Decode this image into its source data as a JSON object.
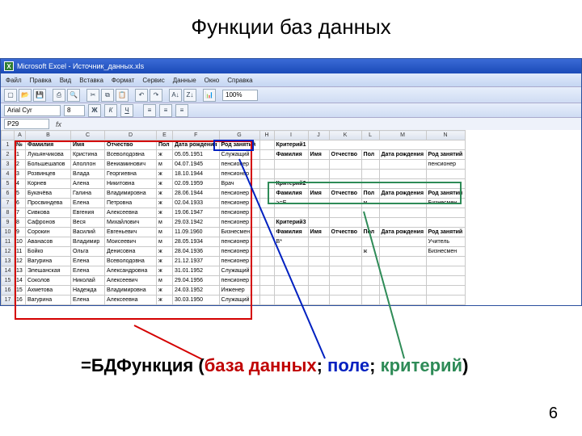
{
  "slide": {
    "title": "Функции баз данных",
    "page_number": "6"
  },
  "window": {
    "app_title": "Microsoft Excel - Источник_данных.xls"
  },
  "menu": {
    "items": [
      "Файл",
      "Правка",
      "Вид",
      "Вставка",
      "Формат",
      "Сервис",
      "Данные",
      "Окно",
      "Справка"
    ]
  },
  "toolbar": {
    "zoom": "100%"
  },
  "format_bar": {
    "font": "Arial Cyr",
    "size": "8"
  },
  "formula_bar": {
    "name_box": "P29",
    "fx": "fx"
  },
  "columns": [
    "",
    "A",
    "B",
    "C",
    "D",
    "E",
    "F",
    "G",
    "H",
    "I",
    "J",
    "K",
    "L",
    "M",
    "N"
  ],
  "db": {
    "headers": {
      "num": "№",
      "fam": "Фамилия",
      "name": "Имя",
      "ot": "Отчество",
      "pol": "Пол",
      "date": "Дата рождения",
      "rod": "Род занятий"
    },
    "rows": [
      {
        "n": "1",
        "fam": "Лукьянчикова",
        "name": "Кристина",
        "ot": "Всеволодовна",
        "pol": "ж",
        "date": "05.05.1951",
        "rod": "Служащий"
      },
      {
        "n": "2",
        "fam": "Большешапов",
        "name": "Аполлон",
        "ot": "Вениаминович",
        "pol": "м",
        "date": "04.07.1945",
        "rod": "пенсионер"
      },
      {
        "n": "3",
        "fam": "Розвинцев",
        "name": "Влада",
        "ot": "Георгиевна",
        "pol": "ж",
        "date": "18.10.1944",
        "rod": "пенсионер"
      },
      {
        "n": "4",
        "fam": "Корнев",
        "name": "Алена",
        "ot": "Никитовна",
        "pol": "ж",
        "date": "02.09.1959",
        "rod": "Врач"
      },
      {
        "n": "5",
        "fam": "Букачёва",
        "name": "Галина",
        "ot": "Владимировна",
        "pol": "ж",
        "date": "28.06.1944",
        "rod": "пенсионер"
      },
      {
        "n": "6",
        "fam": "Просвиндева",
        "name": "Елена",
        "ot": "Петровна",
        "pol": "ж",
        "date": "02.04.1933",
        "rod": "пенсионер"
      },
      {
        "n": "7",
        "fam": "Сивкова",
        "name": "Евгения",
        "ot": "Алексеевна",
        "pol": "ж",
        "date": "19.06.1947",
        "rod": "пенсионер"
      },
      {
        "n": "8",
        "fam": "Сафронов",
        "name": "Веся",
        "ot": "Михайлович",
        "pol": "м",
        "date": "29.03.1942",
        "rod": "пенсионер"
      },
      {
        "n": "9",
        "fam": "Сорокин",
        "name": "Василий",
        "ot": "Евгеньевич",
        "pol": "м",
        "date": "11.09.1960",
        "rod": "Бизнесмен"
      },
      {
        "n": "10",
        "fam": "Аванасов",
        "name": "Владимир",
        "ot": "Моисеевич",
        "pol": "м",
        "date": "28.05.1934",
        "rod": "пенсионер"
      },
      {
        "n": "11",
        "fam": "Бойко",
        "name": "Ольга",
        "ot": "Денисовна",
        "pol": "ж",
        "date": "28.04.1936",
        "rod": "пенсионер"
      },
      {
        "n": "12",
        "fam": "Вагурина",
        "name": "Елена",
        "ot": "Всеволодовна",
        "pol": "ж",
        "date": "21.12.1937",
        "rod": "пенсионер"
      },
      {
        "n": "13",
        "fam": "Элешанская",
        "name": "Елена",
        "ot": "Александровна",
        "pol": "ж",
        "date": "31.01.1952",
        "rod": "Служащий"
      },
      {
        "n": "14",
        "fam": "Соколов",
        "name": "Николай",
        "ot": "Алексеевич",
        "pol": "м",
        "date": "29.04.1956",
        "rod": "пенсионер"
      },
      {
        "n": "15",
        "fam": "Ахметова",
        "name": "Надежда",
        "ot": "Владимировна",
        "pol": "ж",
        "date": "24.03.1952",
        "rod": "Инженер"
      },
      {
        "n": "16",
        "fam": "Вагурина",
        "name": "Елена",
        "ot": "Алексеевна",
        "pol": "ж",
        "date": "30.03.1950",
        "rod": "Служащий"
      }
    ]
  },
  "criteria": [
    {
      "label": "Критерий1",
      "headers": {
        "fam": "Фамилия",
        "name": "Имя",
        "ot": "Отчество",
        "pol": "Пол",
        "date": "Дата рождения",
        "rod": "Род занятий"
      },
      "row": {
        "fam": "",
        "name": "",
        "ot": "",
        "pol": "",
        "date": "",
        "rod": "пенсионер"
      }
    },
    {
      "label": "Критерий2",
      "headers": {
        "fam": "Фамилия",
        "name": "Имя",
        "ot": "Отчество",
        "pol": "Пол",
        "date": "Дата рождения",
        "rod": "Род занятий"
      },
      "row": {
        "fam": ">=Е",
        "name": "",
        "ot": "",
        "pol": "м",
        "date": "",
        "rod": "Бизнесмен"
      }
    },
    {
      "label": "Критерий3",
      "headers": {
        "fam": "Фамилия",
        "name": "Имя",
        "ot": "Отчество",
        "pol": "Пол",
        "date": "Дата рождения",
        "rod": "Род занятий"
      },
      "row1": {
        "fam": "В*",
        "name": "",
        "ot": "",
        "pol": "",
        "date": "",
        "rod": "Учитель"
      },
      "row2": {
        "fam": "",
        "name": "",
        "ot": "",
        "pol": "ж",
        "date": "",
        "rod": "Бизнесмен"
      }
    }
  ],
  "formula": {
    "eq": "=БДФункция",
    "open": " (",
    "p1": "база данных",
    "sep1": "; ",
    "p2": "поле",
    "sep2": "; ",
    "p3": "критерий",
    "close": ")"
  }
}
